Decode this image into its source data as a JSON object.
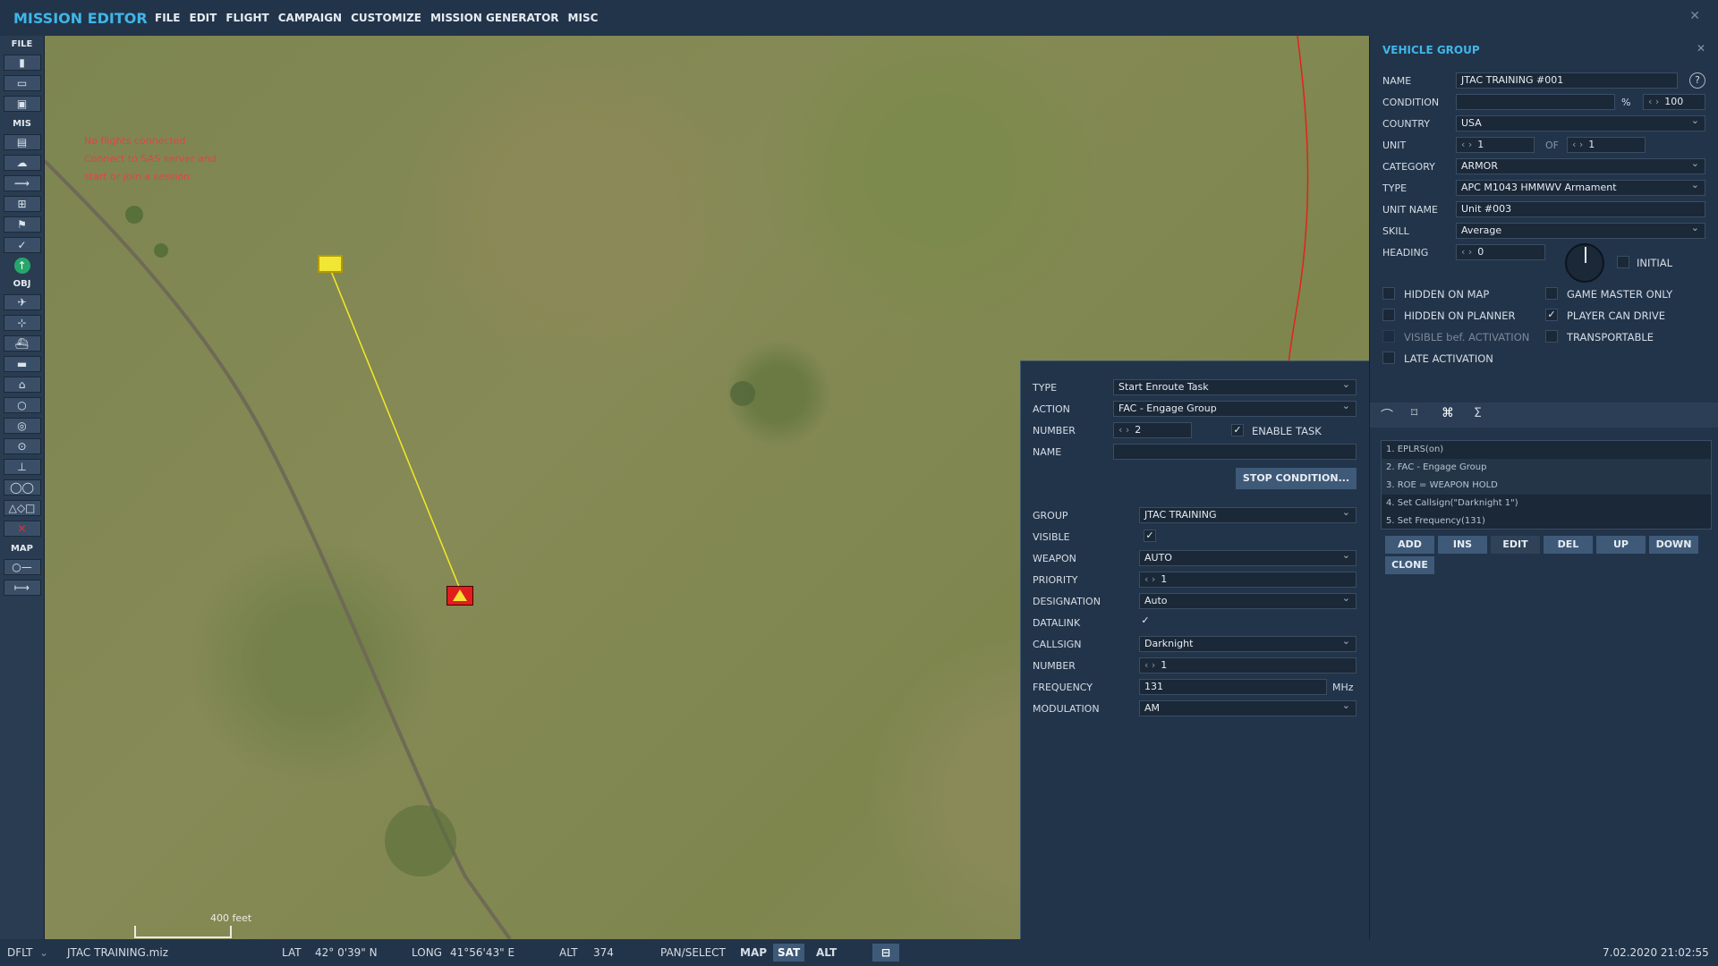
{
  "app": {
    "title": "MISSION EDITOR",
    "close_glyph": "✕"
  },
  "menu": [
    "FILE",
    "EDIT",
    "FLIGHT",
    "CAMPAIGN",
    "CUSTOMIZE",
    "MISSION GENERATOR",
    "MISC"
  ],
  "toolbar": {
    "file_label": "FILE",
    "mis_label": "MIS",
    "obj_label": "OBJ",
    "map_label": "MAP"
  },
  "map": {
    "message_lines": [
      "No flights connected",
      "Connect to SAS server and",
      "start or join a session"
    ],
    "scale_label": "400 feet"
  },
  "task": {
    "type_label": "TYPE",
    "type_value": "Start Enroute Task",
    "action_label": "ACTION",
    "action_value": "FAC - Engage Group",
    "number_label": "NUMBER",
    "number_value": "2",
    "enable_label": "ENABLE TASK",
    "name_label": "NAME",
    "name_value": "",
    "stop_button": "STOP CONDITION...",
    "group_label": "GROUP",
    "group_value": "JTAC TRAINING",
    "visible_label": "VISIBLE",
    "weapon_label": "WEAPON",
    "weapon_value": "AUTO",
    "priority_label": "PRIORITY",
    "priority_value": "1",
    "designation_label": "DESIGNATION",
    "designation_value": "Auto",
    "datalink_label": "DATALINK",
    "callsign_label": "CALLSIGN",
    "callsign_value": "Darknight",
    "number2_label": "NUMBER",
    "number2_value": "1",
    "frequency_label": "FREQUENCY",
    "frequency_value": "131",
    "frequency_unit": "MHz",
    "modulation_label": "MODULATION",
    "modulation_value": "AM"
  },
  "group": {
    "title": "VEHICLE GROUP",
    "name_label": "NAME",
    "name_value": "JTAC TRAINING #001",
    "condition_label": "CONDITION",
    "condition_value": "",
    "condition_pct": "%",
    "condition_max": "100",
    "country_label": "COUNTRY",
    "country_value": "USA",
    "unit_label": "UNIT",
    "unit_value": "1",
    "unit_of": "OF",
    "unit_total": "1",
    "category_label": "CATEGORY",
    "category_value": "ARMOR",
    "type_label": "TYPE",
    "type_value": "APC M1043 HMMWV Armament",
    "unitname_label": "UNIT NAME",
    "unitname_value": "Unit #003",
    "skill_label": "SKILL",
    "skill_value": "Average",
    "heading_label": "HEADING",
    "heading_value": "0",
    "initial_label": "INITIAL",
    "checks": {
      "hidden_on_map": "HIDDEN ON MAP",
      "game_master_only": "GAME MASTER ONLY",
      "hidden_on_planner": "HIDDEN ON PLANNER",
      "player_can_drive": "PLAYER CAN DRIVE",
      "visible_bef_activation": "VISIBLE bef. ACTIVATION",
      "transportable": "TRANSPORTABLE",
      "late_activation": "LATE ACTIVATION"
    },
    "tasks": [
      "1. EPLRS(on)",
      "2. FAC - Engage Group",
      "3. ROE = WEAPON HOLD",
      "4. Set Callsign(\"Darknight 1\")",
      "5. Set Frequency(131)"
    ],
    "buttons": {
      "add": "ADD",
      "ins": "INS",
      "edit": "EDIT",
      "del": "DEL",
      "up": "UP",
      "down": "DOWN",
      "clone": "CLONE"
    }
  },
  "status": {
    "layer": "DFLT",
    "file": "JTAC TRAINING.miz",
    "lat_label": "LAT",
    "lat_value": "42° 0'39\" N",
    "long_label": "LONG",
    "long_value": "41°56'43\" E",
    "alt_label": "ALT",
    "alt_value": "374",
    "mode": "PAN/SELECT",
    "map_btn": "MAP",
    "sat_btn": "SAT",
    "alt_btn": "ALT",
    "datetime": "7.02.2020 21:02:55"
  }
}
